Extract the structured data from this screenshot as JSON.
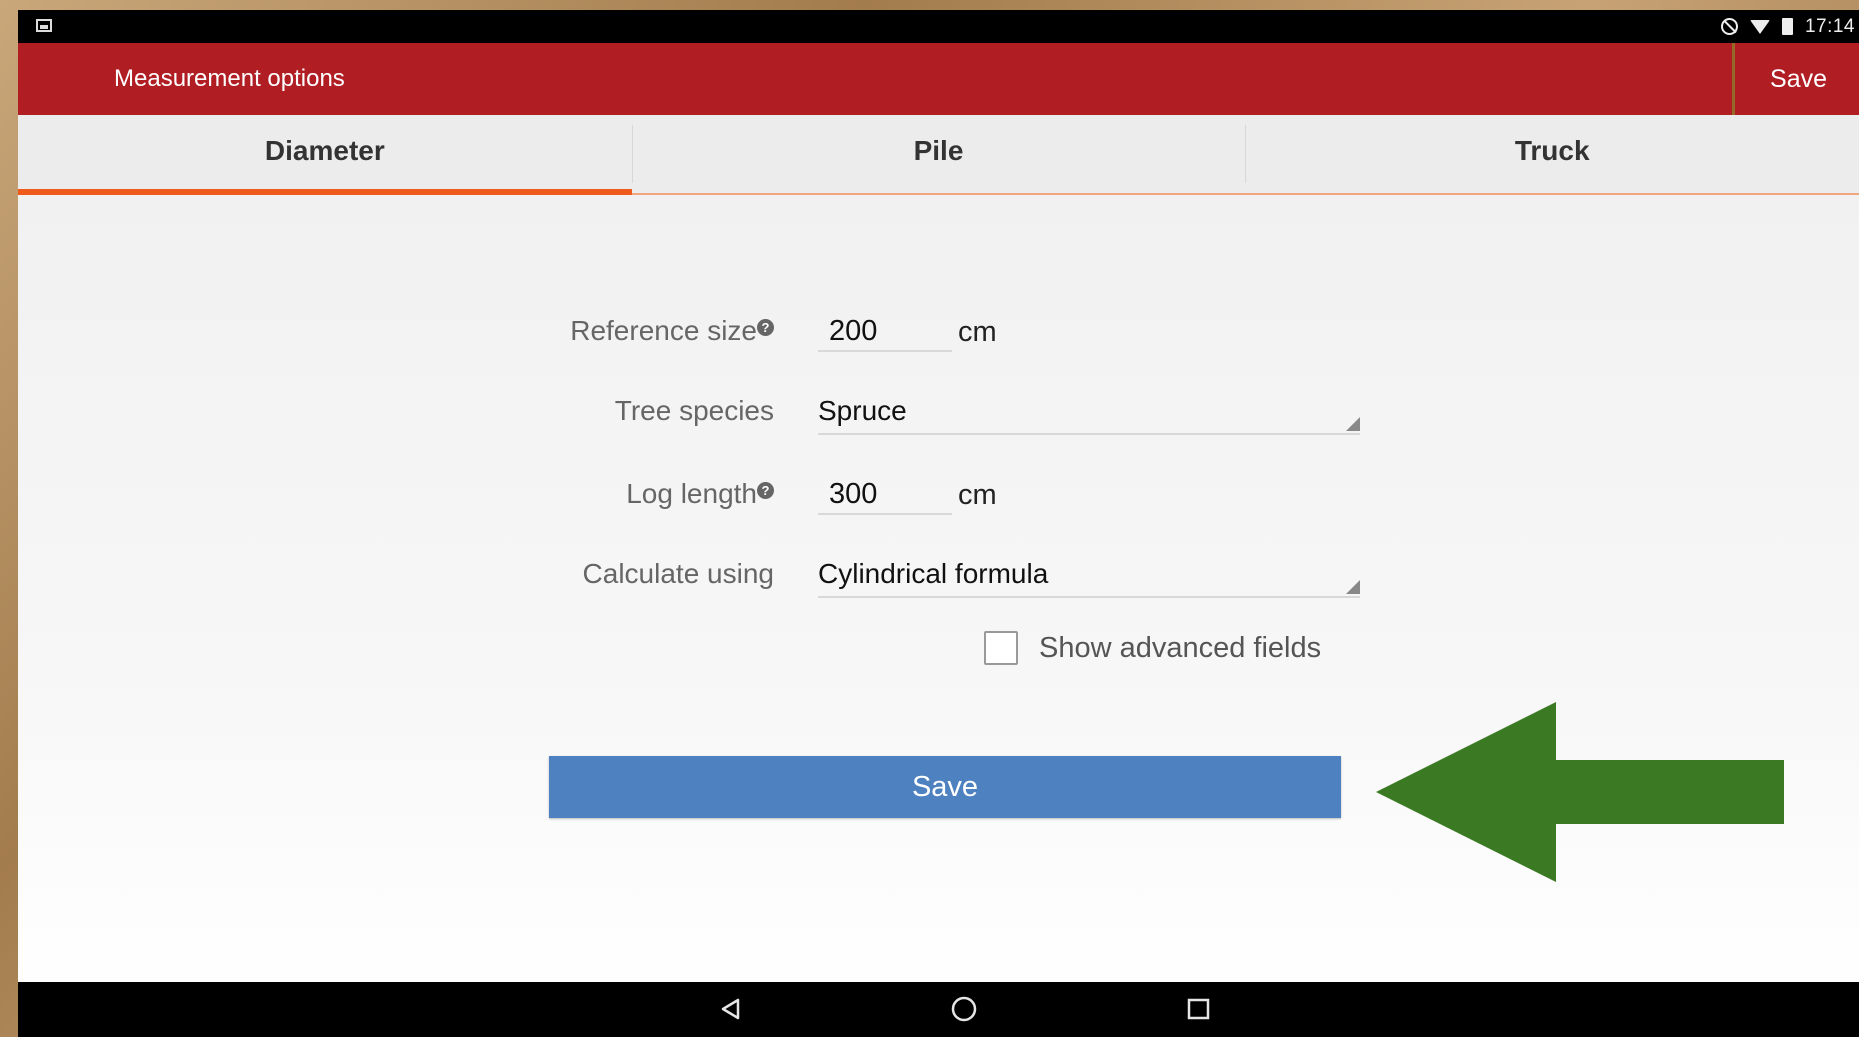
{
  "status_bar": {
    "time": "17:14",
    "icons": [
      "gallery-icon",
      "do-not-disturb-icon",
      "wifi-icon",
      "battery-icon"
    ]
  },
  "app_bar": {
    "title": "Measurement options",
    "save_label": "Save",
    "color": "#b01e24"
  },
  "tabs": [
    {
      "label": "Diameter",
      "active": true
    },
    {
      "label": "Pile",
      "active": false
    },
    {
      "label": "Truck",
      "active": false
    }
  ],
  "form": {
    "reference_size": {
      "label": "Reference size",
      "value": "200",
      "unit": "cm"
    },
    "tree_species": {
      "label": "Tree species",
      "value": "Spruce"
    },
    "log_length": {
      "label": "Log length",
      "value": "300",
      "unit": "cm"
    },
    "calculate_using": {
      "label": "Calculate using",
      "value": "Cylindrical formula"
    },
    "advanced": {
      "label": "Show advanced fields",
      "checked": false
    },
    "save_label": "Save"
  },
  "colors": {
    "accent_tab": "#f05a1a",
    "save_button": "#4e81c0",
    "arrow": "#3b7a23"
  },
  "nav_bar": {
    "icons": [
      "back-icon",
      "home-icon",
      "recents-icon"
    ]
  }
}
